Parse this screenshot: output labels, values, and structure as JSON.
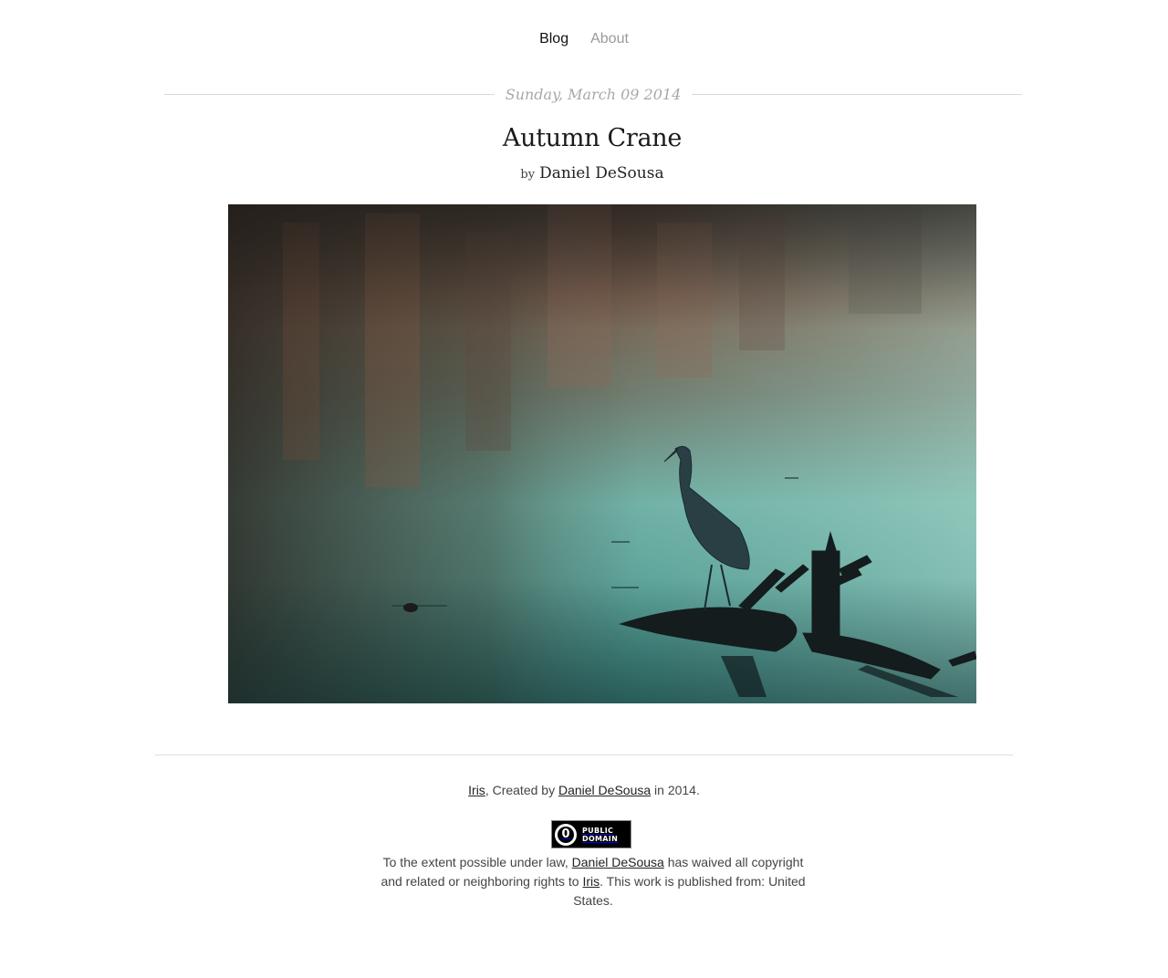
{
  "nav": {
    "blog_label": "Blog",
    "about_label": "About"
  },
  "post": {
    "date": "Sunday, March 09 2014",
    "title": "Autumn Crane",
    "by_label": "by",
    "author": "Daniel DeSousa"
  },
  "footer": {
    "site_link": "Iris",
    "created_by_text": ", Created by ",
    "author_link": "Daniel DeSousa",
    "created_year_text": " in 2014.",
    "badge_number": "0",
    "badge_line1": "PUBLIC",
    "badge_line2": "DOMAIN",
    "license_prefix": "To the extent possible under law, ",
    "license_author_link": "Daniel DeSousa",
    "license_middle": " has waived all copyright and related or neighboring rights to ",
    "license_site_link": "Iris",
    "license_suffix": ". This work is published from: United States."
  },
  "colors": {
    "water": "#5fa9a1",
    "autumn": "#8a6a55",
    "text": "#444444"
  }
}
